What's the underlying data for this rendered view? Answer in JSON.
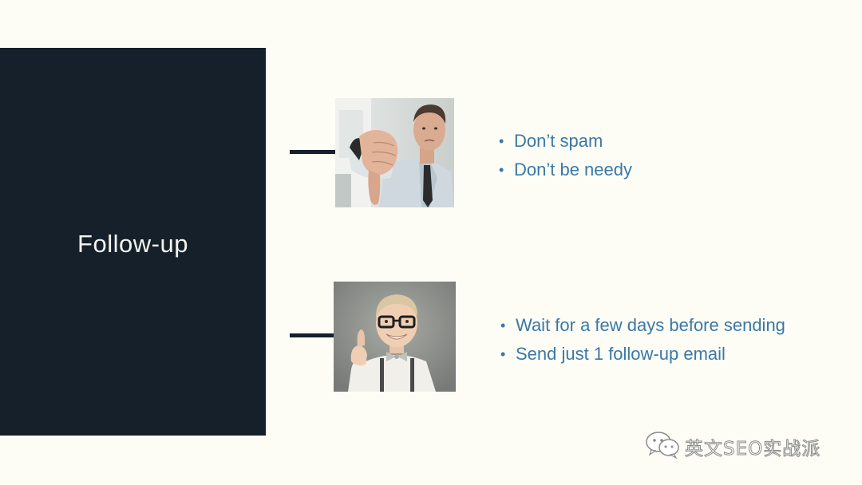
{
  "slide": {
    "title": "Follow-up"
  },
  "sections": [
    {
      "image_icon": "thumbs-down-man-photo",
      "bullets": [
        "Don’t spam",
        "Don’t be needy"
      ]
    },
    {
      "image_icon": "thumbs-up-boy-photo",
      "bullets": [
        "Wait for a few days before sending",
        "Send just 1 follow-up email"
      ]
    }
  ],
  "watermark": {
    "icon": "wechat-icon",
    "text": "英文SEO实战派"
  },
  "colors": {
    "background": "#fdfdf6",
    "panel": "#15202b",
    "bullet_text": "#3a78a6",
    "title_text": "#f4f4ee"
  }
}
